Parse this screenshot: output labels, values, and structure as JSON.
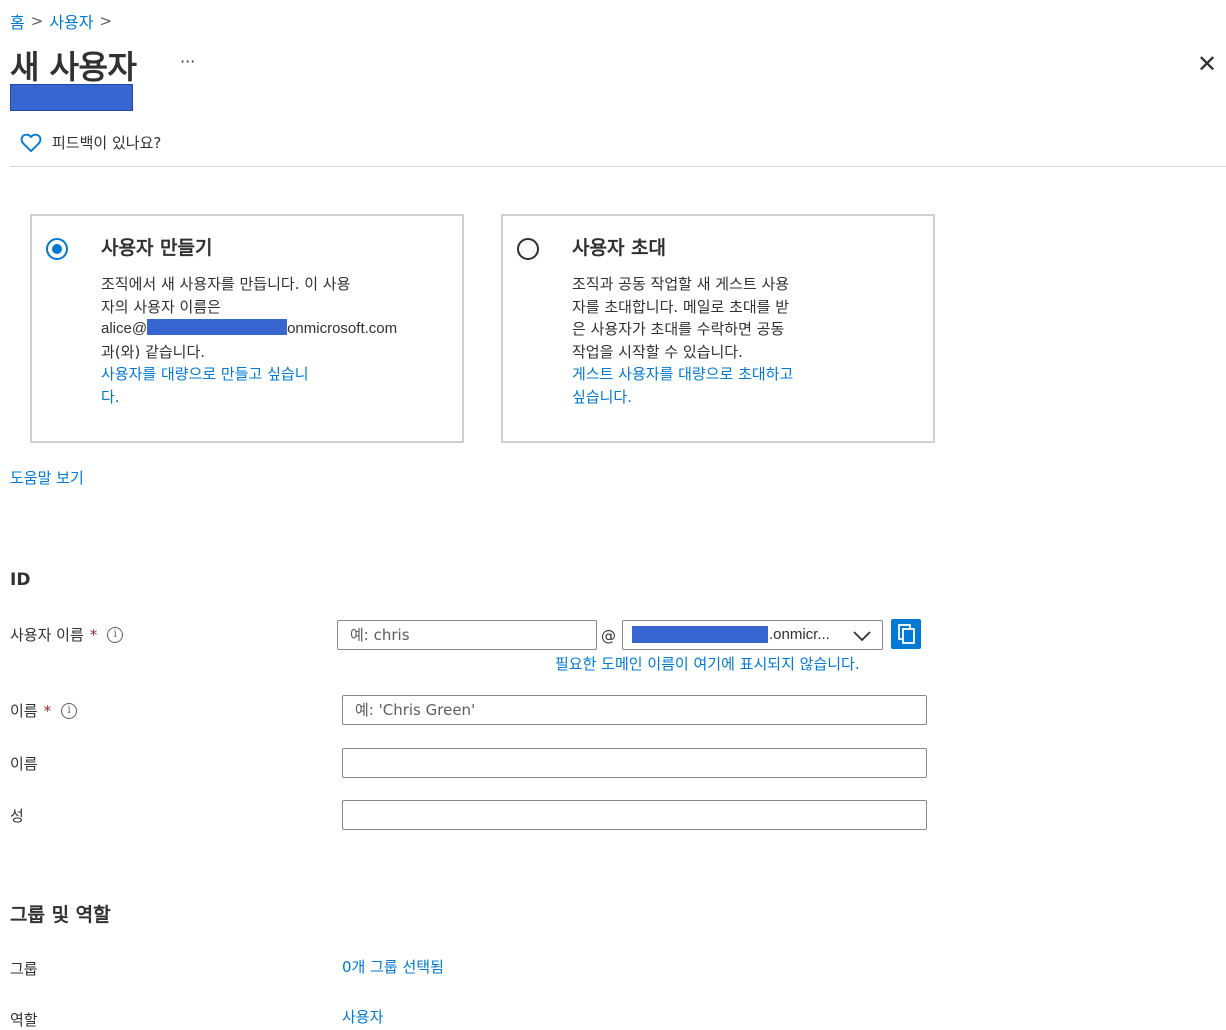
{
  "breadcrumb": {
    "home": "홈",
    "sep": ">",
    "users": "사용자",
    "sep2": ">"
  },
  "page": {
    "title": "새 사용자",
    "more": "···",
    "close": "✕"
  },
  "feedback": {
    "label": "피드백이 있나요?"
  },
  "options": {
    "create": {
      "title": "사용자 만들기",
      "selected": true,
      "line1": "조직에서 새 사용자를 만듭니다. 이 사용",
      "line2": "자의 사용자 이름은",
      "email_prefix": "alice@",
      "email_suffix": "onmicrosoft.com",
      "line4": "과(와) 같습니다.",
      "link_line1": "사용자를 대량으로 만들고 싶습니",
      "link_line2": "다."
    },
    "invite": {
      "title": "사용자 초대",
      "selected": false,
      "line1": "조직과 공동 작업할 새 게스트 사용",
      "line2": "자를 초대합니다. 메일로 초대를 받",
      "line3": "은 사용자가 초대를 수락하면 공동",
      "line4": "작업을 시작할 수 있습니다.",
      "link_line1": "게스트 사용자를 대량으로 초대하고",
      "link_line2": "싶습니다."
    }
  },
  "help_link": "도움말 보기",
  "identity": {
    "heading": "ID",
    "username_label": "사용자 이름",
    "required": "*",
    "info": "i",
    "username_placeholder": "예: chris",
    "at": "@",
    "domain_value": ".onmicr...",
    "domain_hint": "필요한 도메인 이름이 여기에 표시되지 않습니다.",
    "name_label": "이름",
    "name_placeholder": "예: 'Chris Green'",
    "first_name_label": "이름",
    "last_name_label": "성"
  },
  "groups_roles": {
    "heading": "그룹 및 역할",
    "groups_label": "그룹",
    "groups_value": "0개 그룹 선택됨",
    "roles_label": "역할",
    "roles_value": "사용자"
  },
  "colors": {
    "accent": "#0078d4",
    "required": "#a4262c",
    "redaction": "#3866d0"
  }
}
